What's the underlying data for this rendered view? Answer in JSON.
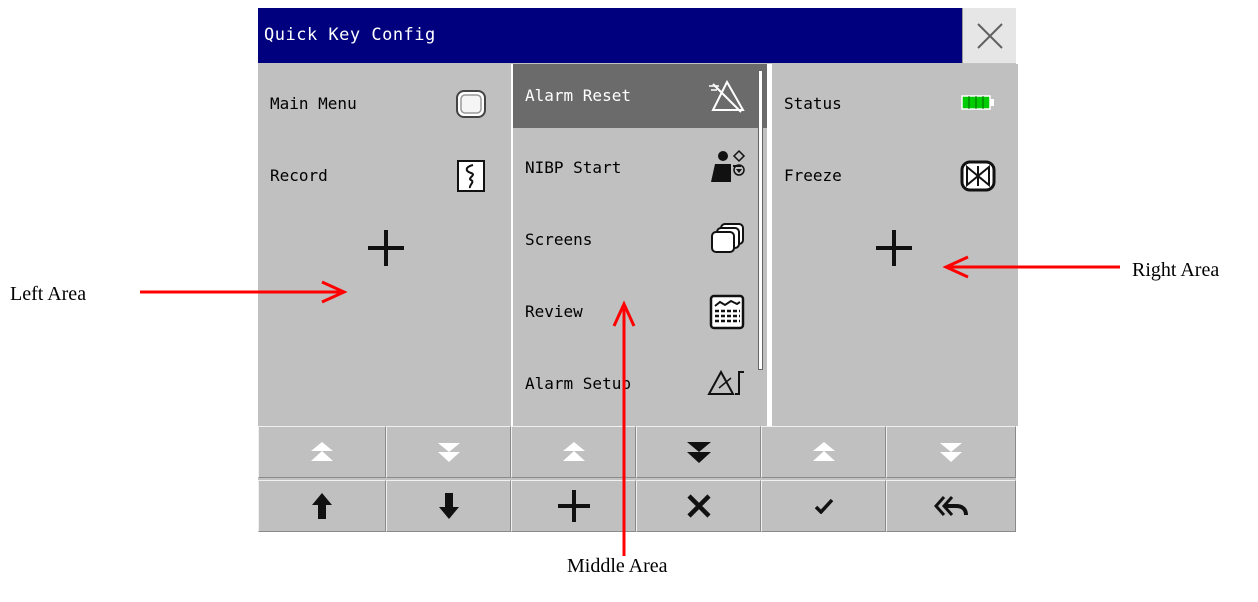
{
  "dialog": {
    "title": "Quick Key Config",
    "close_icon": "close-icon",
    "colors": {
      "title_bg": "#00007f",
      "panel": "#c0c0c0",
      "selected": "#6b6b6b",
      "arrow": "#ff0000"
    }
  },
  "left_area": {
    "items": [
      {
        "label": "Main Menu",
        "icon": "main-menu-icon"
      },
      {
        "label": "Record",
        "icon": "record-icon"
      }
    ],
    "add_icon": "plus-icon"
  },
  "middle_area": {
    "items": [
      {
        "label": "Alarm Reset",
        "icon": "alarm-reset-icon",
        "selected": true
      },
      {
        "label": "NIBP Start",
        "icon": "nibp-start-icon"
      },
      {
        "label": "Screens",
        "icon": "screens-icon"
      },
      {
        "label": "Review",
        "icon": "review-icon"
      },
      {
        "label": "Alarm Setup",
        "icon": "alarm-setup-icon"
      }
    ]
  },
  "right_area": {
    "items": [
      {
        "label": "Status",
        "icon": "battery-icon"
      },
      {
        "label": "Freeze",
        "icon": "freeze-icon"
      }
    ],
    "add_icon": "plus-icon"
  },
  "bottom_bar": {
    "row1": [
      "page-up-icon",
      "page-down-icon",
      "page-up-icon",
      "page-down-icon",
      "page-up-icon",
      "page-down-icon"
    ],
    "row2": [
      "arrow-up-icon",
      "arrow-down-icon",
      "add-icon",
      "delete-icon",
      "confirm-icon",
      "back-icon"
    ]
  },
  "annotations": {
    "left": "Left Area",
    "right": "Right Area",
    "middle": "Middle Area"
  }
}
